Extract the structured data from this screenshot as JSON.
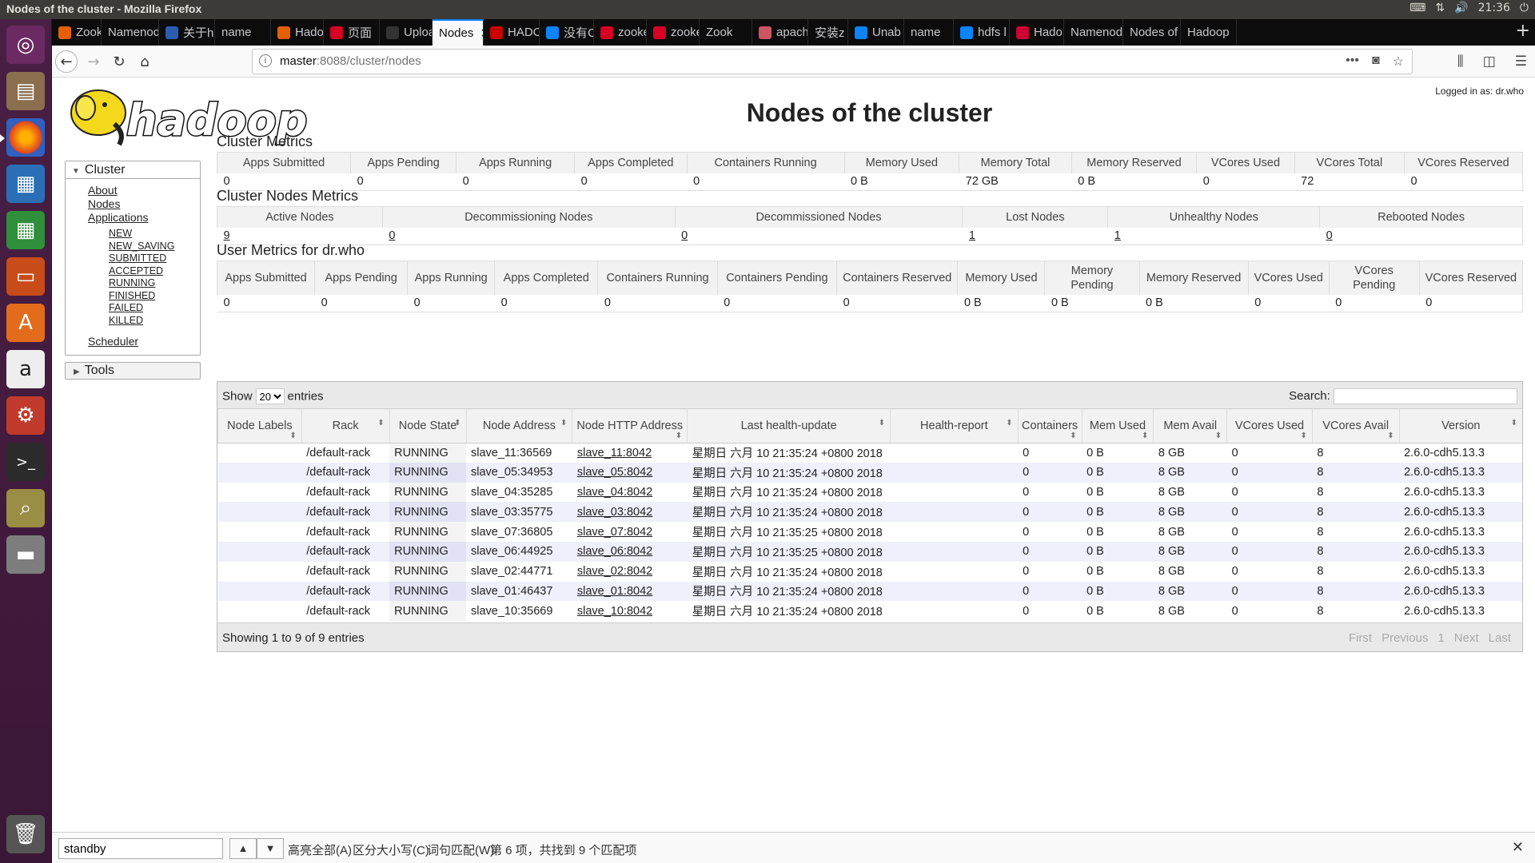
{
  "window": {
    "title": "Nodes of the cluster - Mozilla Firefox",
    "clock": "21:36"
  },
  "launcher": [
    "ubuntu-dash",
    "files",
    "firefox",
    "writer",
    "calc",
    "impress",
    "software-center",
    "amazon",
    "settings",
    "terminal",
    "image-viewer",
    "disk",
    "trash"
  ],
  "tabs": [
    {
      "label": "Zook",
      "fav": "#e66000"
    },
    {
      "label": "Namenod",
      "fav": ""
    },
    {
      "label": "关于h",
      "fav": "#2a5db0"
    },
    {
      "label": "name",
      "fav": ""
    },
    {
      "label": "Hado",
      "fav": "#e66000"
    },
    {
      "label": "页面",
      "fav": "#d70022"
    },
    {
      "label": "Uploa",
      "fav": "#333"
    },
    {
      "label": "Nodes",
      "fav": "",
      "active": true
    },
    {
      "label": "HADC",
      "fav": "#c00"
    },
    {
      "label": "没有C",
      "fav": "#0a84ff"
    },
    {
      "label": "zooke",
      "fav": "#d70022"
    },
    {
      "label": "zooke",
      "fav": "#d70022"
    },
    {
      "label": "Zook",
      "fav": ""
    },
    {
      "label": "apach",
      "fav": "#c56"
    },
    {
      "label": "安装z",
      "fav": ""
    },
    {
      "label": "Unab",
      "fav": "#0a84ff"
    },
    {
      "label": "name",
      "fav": ""
    },
    {
      "label": "hdfs l",
      "fav": "#0a84ff"
    },
    {
      "label": "Hado",
      "fav": "#c03"
    },
    {
      "label": "Namenod",
      "fav": ""
    },
    {
      "label": "Nodes of",
      "fav": ""
    },
    {
      "label": "Hadoop",
      "fav": ""
    }
  ],
  "url": {
    "host": "master",
    "path": ":8088/cluster/nodes"
  },
  "page": {
    "logo_text": "hadoop",
    "logged_in": "Logged in as: dr.who",
    "title": "Nodes of the cluster"
  },
  "sidebar": {
    "cluster_label": "Cluster",
    "links": [
      "About",
      "Nodes",
      "Applications"
    ],
    "app_states": [
      "NEW",
      "NEW_SAVING",
      "SUBMITTED",
      "ACCEPTED",
      "RUNNING",
      "FINISHED",
      "FAILED",
      "KILLED"
    ],
    "scheduler": "Scheduler",
    "tools_label": "Tools"
  },
  "cluster_metrics": {
    "title": "Cluster Metrics",
    "headers": [
      "Apps Submitted",
      "Apps Pending",
      "Apps Running",
      "Apps Completed",
      "Containers Running",
      "Memory Used",
      "Memory Total",
      "Memory Reserved",
      "VCores Used",
      "VCores Total",
      "VCores Reserved"
    ],
    "values": [
      "0",
      "0",
      "0",
      "0",
      "0",
      "0 B",
      "72 GB",
      "0 B",
      "0",
      "72",
      "0"
    ]
  },
  "nodes_metrics": {
    "title": "Cluster Nodes Metrics",
    "headers": [
      "Active Nodes",
      "Decommissioning Nodes",
      "Decommissioned Nodes",
      "Lost Nodes",
      "Unhealthy Nodes",
      "Rebooted Nodes"
    ],
    "values": [
      "9",
      "0",
      "0",
      "1",
      "1",
      "0"
    ]
  },
  "user_metrics": {
    "title": "User Metrics for dr.who",
    "headers": [
      "Apps Submitted",
      "Apps Pending",
      "Apps Running",
      "Apps Completed",
      "Containers Running",
      "Containers Pending",
      "Containers Reserved",
      "Memory Used",
      "Memory Pending",
      "Memory Reserved",
      "VCores Used",
      "VCores Pending",
      "VCores Reserved"
    ],
    "values": [
      "0",
      "0",
      "0",
      "0",
      "0",
      "0",
      "0",
      "0 B",
      "0 B",
      "0 B",
      "0",
      "0",
      "0"
    ]
  },
  "nodes_table": {
    "show_label": "Show",
    "show_value": "20",
    "entries_label": "entries",
    "search_label": "Search:",
    "headers": [
      "Node Labels",
      "Rack",
      "Node State",
      "Node Address",
      "Node HTTP Address",
      "Last health-update",
      "Health-report",
      "Containers",
      "Mem Used",
      "Mem Avail",
      "VCores Used",
      "VCores Avail",
      "Version"
    ],
    "rows": [
      [
        "",
        "/default-rack",
        "RUNNING",
        "slave_11:36569",
        "slave_11:8042",
        "星期日 六月 10 21:35:24 +0800 2018",
        "",
        "0",
        "0 B",
        "8 GB",
        "0",
        "8",
        "2.6.0-cdh5.13.3"
      ],
      [
        "",
        "/default-rack",
        "RUNNING",
        "slave_05:34953",
        "slave_05:8042",
        "星期日 六月 10 21:35:24 +0800 2018",
        "",
        "0",
        "0 B",
        "8 GB",
        "0",
        "8",
        "2.6.0-cdh5.13.3"
      ],
      [
        "",
        "/default-rack",
        "RUNNING",
        "slave_04:35285",
        "slave_04:8042",
        "星期日 六月 10 21:35:24 +0800 2018",
        "",
        "0",
        "0 B",
        "8 GB",
        "0",
        "8",
        "2.6.0-cdh5.13.3"
      ],
      [
        "",
        "/default-rack",
        "RUNNING",
        "slave_03:35775",
        "slave_03:8042",
        "星期日 六月 10 21:35:24 +0800 2018",
        "",
        "0",
        "0 B",
        "8 GB",
        "0",
        "8",
        "2.6.0-cdh5.13.3"
      ],
      [
        "",
        "/default-rack",
        "RUNNING",
        "slave_07:36805",
        "slave_07:8042",
        "星期日 六月 10 21:35:25 +0800 2018",
        "",
        "0",
        "0 B",
        "8 GB",
        "0",
        "8",
        "2.6.0-cdh5.13.3"
      ],
      [
        "",
        "/default-rack",
        "RUNNING",
        "slave_06:44925",
        "slave_06:8042",
        "星期日 六月 10 21:35:25 +0800 2018",
        "",
        "0",
        "0 B",
        "8 GB",
        "0",
        "8",
        "2.6.0-cdh5.13.3"
      ],
      [
        "",
        "/default-rack",
        "RUNNING",
        "slave_02:44771",
        "slave_02:8042",
        "星期日 六月 10 21:35:24 +0800 2018",
        "",
        "0",
        "0 B",
        "8 GB",
        "0",
        "8",
        "2.6.0-cdh5.13.3"
      ],
      [
        "",
        "/default-rack",
        "RUNNING",
        "slave_01:46437",
        "slave_01:8042",
        "星期日 六月 10 21:35:24 +0800 2018",
        "",
        "0",
        "0 B",
        "8 GB",
        "0",
        "8",
        "2.6.0-cdh5.13.3"
      ],
      [
        "",
        "/default-rack",
        "RUNNING",
        "slave_10:35669",
        "slave_10:8042",
        "星期日 六月 10 21:35:24 +0800 2018",
        "",
        "0",
        "0 B",
        "8 GB",
        "0",
        "8",
        "2.6.0-cdh5.13.3"
      ]
    ],
    "info": "Showing 1 to 9 of 9 entries",
    "pager": [
      "First",
      "Previous",
      "1",
      "Next",
      "Last"
    ]
  },
  "findbar": {
    "value": "standby",
    "highlight_all": "高亮全部(A)",
    "match_case": "区分大小写(C)",
    "whole_words": "词句匹配(W)",
    "status": "第 6 项，共找到 9 个匹配项"
  }
}
